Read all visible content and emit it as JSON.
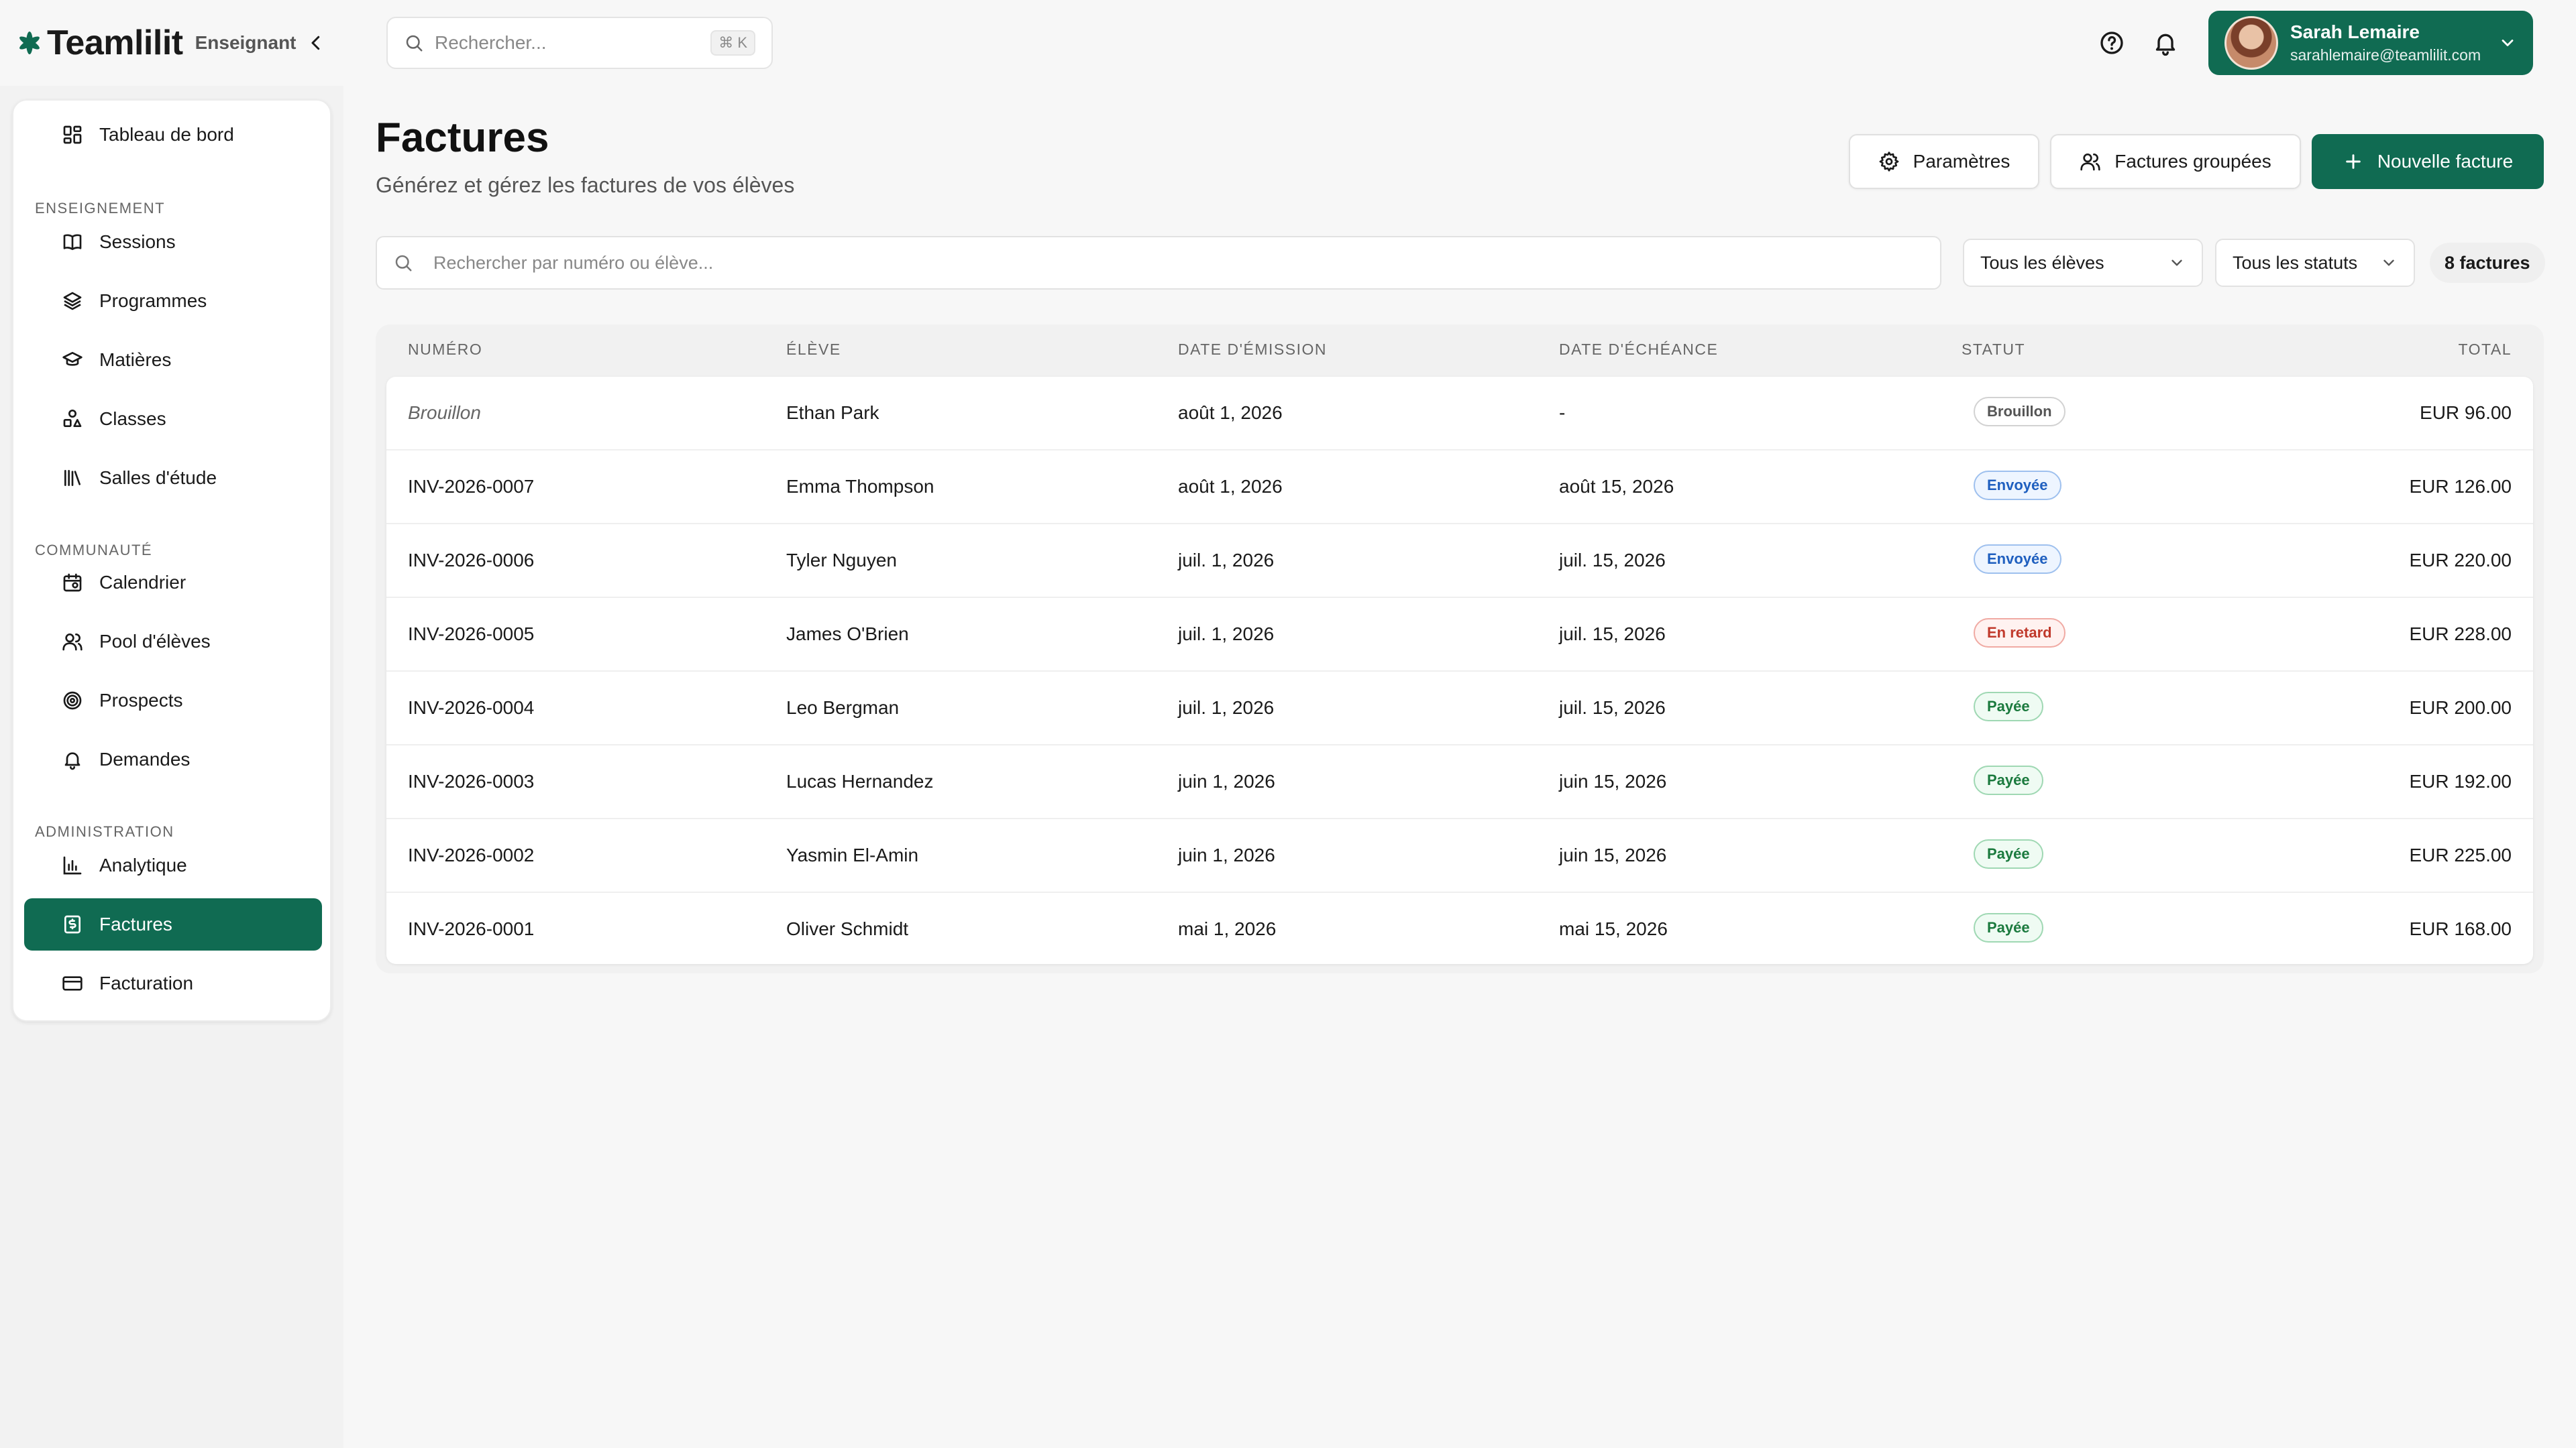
{
  "brand": {
    "name": "Teamlilit",
    "role": "Enseignant"
  },
  "header": {
    "search_placeholder": "Rechercher...",
    "shortcut": "⌘ K",
    "user": {
      "name": "Sarah Lemaire",
      "email": "sarahlemaire@teamlilit.com"
    }
  },
  "sidebar": {
    "top_item": {
      "label": "Tableau de bord",
      "icon": "dashboard-icon"
    },
    "sections": [
      {
        "label": "ENSEIGNEMENT",
        "items": [
          {
            "label": "Sessions",
            "icon": "book-icon"
          },
          {
            "label": "Programmes",
            "icon": "layers-icon"
          },
          {
            "label": "Matières",
            "icon": "graduation-cap-icon"
          },
          {
            "label": "Classes",
            "icon": "shapes-icon"
          },
          {
            "label": "Salles d'étude",
            "icon": "library-icon"
          }
        ]
      },
      {
        "label": "COMMUNAUTÉ",
        "items": [
          {
            "label": "Calendrier",
            "icon": "calendar-icon"
          },
          {
            "label": "Pool d'élèves",
            "icon": "users-icon"
          },
          {
            "label": "Prospects",
            "icon": "target-icon"
          },
          {
            "label": "Demandes",
            "icon": "bell-icon"
          }
        ]
      },
      {
        "label": "ADMINISTRATION",
        "items": [
          {
            "label": "Analytique",
            "icon": "bar-chart-icon"
          },
          {
            "label": "Factures",
            "icon": "invoice-icon",
            "active": true
          },
          {
            "label": "Facturation",
            "icon": "credit-card-icon"
          }
        ]
      }
    ]
  },
  "main": {
    "title": "Factures",
    "subtitle": "Générez et gérez les factures de vos élèves",
    "buttons": {
      "settings": "Paramètres",
      "grouped": "Factures groupées",
      "new_invoice": "Nouvelle facture"
    },
    "filters": {
      "search_placeholder": "Rechercher par numéro ou élève...",
      "students": "Tous les élèves",
      "statuses": "Tous les statuts",
      "count": "8 factures"
    },
    "table": {
      "headers": [
        "NUMÉRO",
        "ÉLÈVE",
        "DATE D'ÉMISSION",
        "DATE D'ÉCHÉANCE",
        "STATUT",
        "TOTAL"
      ],
      "rows": [
        {
          "number": "Brouillon",
          "student": "Ethan Park",
          "issued": "août 1, 2026",
          "due": "-",
          "status": "Brouillon",
          "status_kind": "draft",
          "total": "EUR 96.00"
        },
        {
          "number": "INV-2026-0007",
          "student": "Emma Thompson",
          "issued": "août 1, 2026",
          "due": "août 15, 2026",
          "status": "Envoyée",
          "status_kind": "sent",
          "total": "EUR 126.00"
        },
        {
          "number": "INV-2026-0006",
          "student": "Tyler Nguyen",
          "issued": "juil. 1, 2026",
          "due": "juil. 15, 2026",
          "status": "Envoyée",
          "status_kind": "sent",
          "total": "EUR 220.00"
        },
        {
          "number": "INV-2026-0005",
          "student": "James O'Brien",
          "issued": "juil. 1, 2026",
          "due": "juil. 15, 2026",
          "status": "En retard",
          "status_kind": "late",
          "total": "EUR 228.00"
        },
        {
          "number": "INV-2026-0004",
          "student": "Leo Bergman",
          "issued": "juil. 1, 2026",
          "due": "juil. 15, 2026",
          "status": "Payée",
          "status_kind": "paid",
          "total": "EUR 200.00"
        },
        {
          "number": "INV-2026-0003",
          "student": "Lucas Hernandez",
          "issued": "juin 1, 2026",
          "due": "juin 15, 2026",
          "status": "Payée",
          "status_kind": "paid",
          "total": "EUR 192.00"
        },
        {
          "number": "INV-2026-0002",
          "student": "Yasmin El-Amin",
          "issued": "juin 1, 2026",
          "due": "juin 15, 2026",
          "status": "Payée",
          "status_kind": "paid",
          "total": "EUR 225.00"
        },
        {
          "number": "INV-2026-0001",
          "student": "Oliver Schmidt",
          "issued": "mai 1, 2026",
          "due": "mai 15, 2026",
          "status": "Payée",
          "status_kind": "paid",
          "total": "EUR 168.00"
        }
      ]
    }
  },
  "colors": {
    "accent": "#106b52",
    "background": "#f7f7f7"
  }
}
